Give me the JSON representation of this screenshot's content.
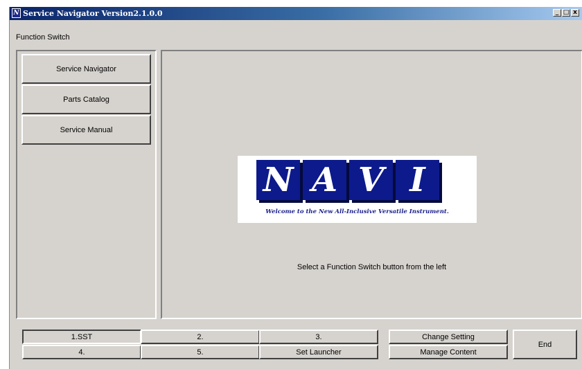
{
  "window": {
    "title": "Service Navigator Version2.1.0.0",
    "app_icon_letter": "N",
    "controls": {
      "minimize": "_",
      "maximize": "□",
      "close": "x"
    }
  },
  "function_switch": {
    "label": "Function Switch",
    "buttons": [
      "Service Navigator",
      "Parts Catalog",
      "Service Manual"
    ]
  },
  "main": {
    "logo": {
      "letters": [
        "N",
        "A",
        "V",
        "I"
      ],
      "tagline": "Welcome to the New All-Inclusive Versatile Instrument."
    },
    "prompt": "Select a Function Switch button from the left"
  },
  "bottom_bar": {
    "row1": [
      "1.SST",
      "2.",
      "3."
    ],
    "row2": [
      "4.",
      "5.",
      "Set Launcher"
    ],
    "change_setting": "Change Setting",
    "manage_content": "Manage Content",
    "end": "End"
  },
  "colors": {
    "title_bar_start": "#0a246a",
    "title_bar_end": "#a6caf0",
    "face": "#d6d3ce",
    "logo_tile": "#0d1a8c"
  }
}
